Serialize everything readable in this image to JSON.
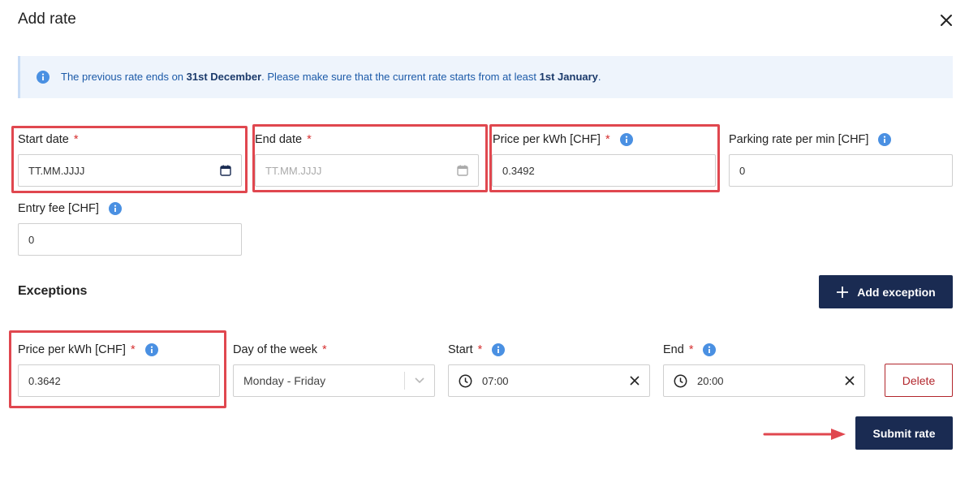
{
  "dialog": {
    "title": "Add rate",
    "close_icon": "close-icon"
  },
  "banner": {
    "text_prefix": "The previous rate ends on ",
    "end_date": "31st December",
    "text_middle": ". Please make sure that the current rate starts from at least ",
    "start_date": "1st January",
    "text_suffix": ".",
    "icon": "info-icon"
  },
  "form": {
    "start_date": {
      "label": "Start date",
      "required_mark": "*",
      "placeholder": "TT.MM.JJJJ",
      "icon": "calendar-icon"
    },
    "end_date": {
      "label": "End date",
      "required_mark": "*",
      "placeholder": "TT.MM.JJJJ",
      "icon": "calendar-icon",
      "disabled": true
    },
    "price_kwh": {
      "label": "Price per kWh [CHF]",
      "required_mark": "*",
      "value": "0.3492",
      "icon": "info-icon"
    },
    "parking_rate": {
      "label": "Parking rate per min [CHF]",
      "value": "0",
      "icon": "info-icon"
    },
    "entry_fee": {
      "label": "Entry fee [CHF]",
      "value": "0",
      "icon": "info-icon"
    }
  },
  "exceptions": {
    "title": "Exceptions",
    "add_button": "Add exception",
    "row": {
      "price": {
        "label": "Price per kWh [CHF]",
        "required_mark": "*",
        "value": "0.3642"
      },
      "day": {
        "label": "Day of the week",
        "required_mark": "*",
        "value": "Monday - Friday"
      },
      "start": {
        "label": "Start",
        "required_mark": "*",
        "value": "07:00"
      },
      "end": {
        "label": "End",
        "required_mark": "*",
        "value": "20:00"
      },
      "delete_button": "Delete"
    }
  },
  "submit_button": "Submit rate",
  "colors": {
    "primary": "#1a2b52",
    "danger": "#b2262c",
    "highlight": "#e0474f",
    "banner_bg": "#eef4fc",
    "info_blue": "#4a90e2"
  }
}
